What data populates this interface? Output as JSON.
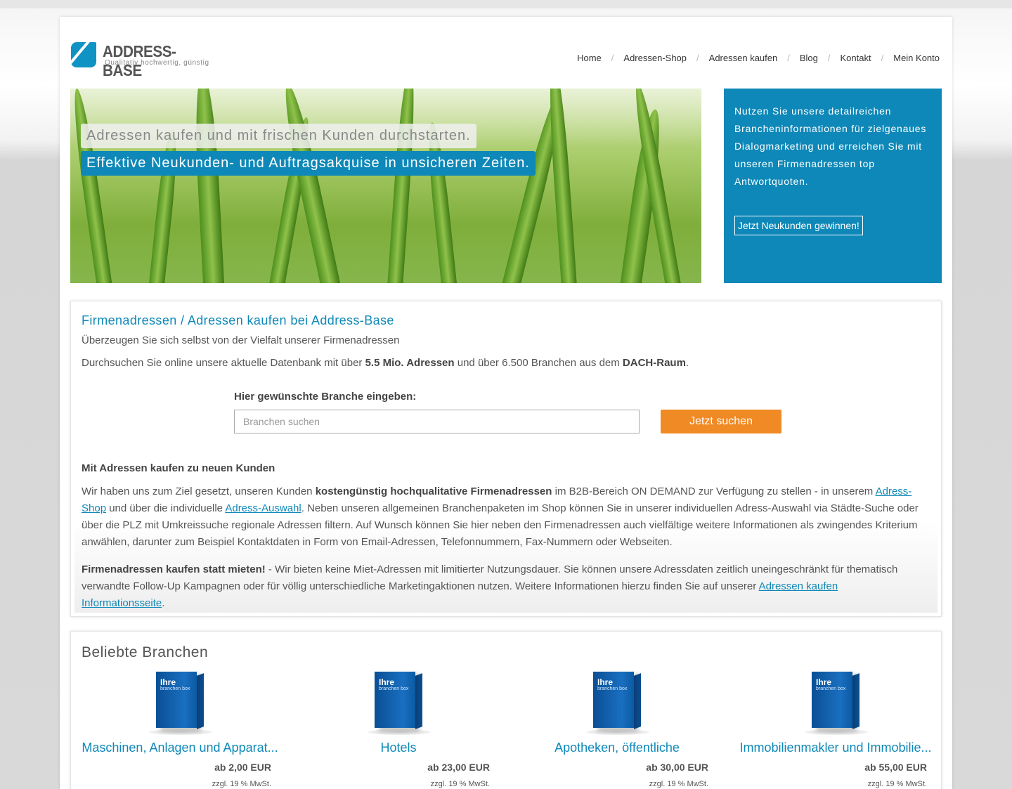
{
  "header": {
    "logo_title": "ADDRESS-BASE",
    "logo_subtitle": "Qualitativ hochwertig, günstig",
    "nav": [
      "Home",
      "Adressen-Shop",
      "Adressen kaufen",
      "Blog",
      "Kontakt",
      "Mein Konto"
    ],
    "nav_separator": "/"
  },
  "hero": {
    "caption1": "Adressen kaufen und mit frischen Kunden durchstarten.",
    "caption2": "Effektive Neukunden- und Auftragsakquise in unsicheren Zeiten."
  },
  "sidebox": {
    "text": "Nutzen Sie unsere detailreichen Brancheninformationen für zielgenaues Dialogmarketing und erreichen Sie mit unseren Firmenadressen top Antwortquoten.",
    "button": "Jetzt Neukunden gewinnen!"
  },
  "intro": {
    "title": "Firmenadressen / Adressen kaufen bei Address-Base",
    "subtitle": "Überzeugen Sie sich selbst von der Vielfalt unserer Firmenadressen",
    "search_text_a": "Durchsuchen Sie online unsere aktuelle Datenbank mit über ",
    "search_text_b": "5.5 Mio. Adressen",
    "search_text_c": " und über 6.500 Branchen aus dem ",
    "search_text_d": "DACH-Raum",
    "search_text_e": "."
  },
  "search": {
    "label": "Hier gewünschte Branche eingeben:",
    "placeholder": "Branchen suchen",
    "button": "Jetzt suchen"
  },
  "about": {
    "heading": "Mit Adressen kaufen zu neuen Kunden",
    "p1_a": "Wir haben uns zum Ziel gesetzt, unseren Kunden ",
    "p1_b": "kostengünstig hochqualitative Firmenadressen",
    "p1_c": " im B2B-Bereich ON DEMAND zur Verfügung zu stellen - in unserem ",
    "p1_link1": "Adress-Shop",
    "p1_d": " und über die individuelle ",
    "p1_link2": "Adress-Auswahl",
    "p1_e": ". Neben unseren allgemeinen Branchenpaketen im Shop können Sie in unserer individuellen Adress-Auswahl via Städte-Suche oder über die PLZ mit Umkreissuche regionale Adressen filtern. Auf Wunsch können Sie hier neben den Firmenadressen auch vielfältige weitere Informationen als zwingendes Kriterium anwählen, darunter zum Beispiel Kontaktdaten in Form von Email-Adressen, Telefonnummern, Fax-Nummern oder Webseiten.",
    "p2_a": "Firmenadressen kaufen statt mieten!",
    "p2_b": " - Wir bieten keine Miet-Adressen mit limitierter Nutzungsdauer. Sie können unsere Adressdaten zeitlich uneingeschränkt für thematisch verwandte Follow-Up Kampagnen oder für völlig unterschiedliche Marketingaktionen nutzen. Weitere Informationen hierzu finden Sie auf unserer ",
    "p2_link": "Adressen kaufen Informationsseite",
    "p2_c": "."
  },
  "popular": {
    "title": "Beliebte Branchen",
    "box_label1": "Ihre",
    "box_label2": "branchen box",
    "products": [
      {
        "name": "Maschinen, Anlagen und Apparat...",
        "price": "ab 2,00 EUR",
        "tax": "zzgl. 19 % MwSt."
      },
      {
        "name": "Hotels",
        "price": "ab 23,00 EUR",
        "tax": "zzgl. 19 % MwSt."
      },
      {
        "name": "Apotheken, öffentliche",
        "price": "ab 30,00 EUR",
        "tax": "zzgl. 19 % MwSt."
      },
      {
        "name": "Immobilienmakler und Immobilie...",
        "price": "ab 55,00 EUR",
        "tax": "zzgl. 19 % MwSt."
      }
    ]
  },
  "colors": {
    "accent": "#0e88b8",
    "button_orange": "#f08a24"
  }
}
